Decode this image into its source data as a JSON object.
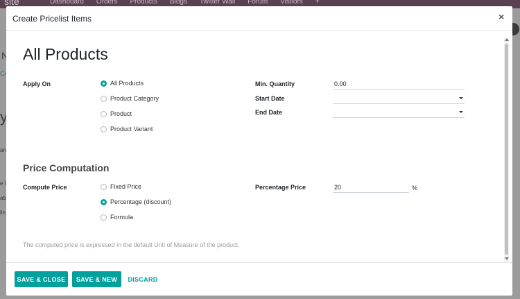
{
  "background": {
    "brand": "site",
    "menu": [
      "Dashboard",
      "Orders",
      "Products",
      "Blogs",
      "Twitter Wall",
      "Forum",
      "Visitors",
      "+"
    ],
    "fragments": [
      "N",
      "CA",
      "y",
      "an",
      "e l",
      "ab",
      "lin"
    ]
  },
  "modal": {
    "title": "Create Pricelist Items",
    "close": "×",
    "heading": "All Products",
    "apply_on": {
      "label": "Apply On",
      "options": [
        "All Products",
        "Product Category",
        "Product",
        "Product Variant"
      ],
      "selected": "All Products"
    },
    "min_quantity": {
      "label": "Min. Quantity",
      "value": "0.00"
    },
    "start_date": {
      "label": "Start Date",
      "value": ""
    },
    "end_date": {
      "label": "End Date",
      "value": ""
    },
    "price_computation": {
      "title": "Price Computation",
      "compute_label": "Compute Price",
      "options": [
        "Fixed Price",
        "Percentage (discount)",
        "Formula"
      ],
      "selected": "Percentage (discount)",
      "percentage_label": "Percentage Price",
      "percentage_value": "20",
      "percentage_unit": "%"
    },
    "help_text": "The computed price is expressed in the default Unit of Measure of the product.",
    "buttons": {
      "save_close": "SAVE & CLOSE",
      "save_new": "SAVE & NEW",
      "discard": "DISCARD"
    }
  },
  "colors": {
    "accent": "#00a09d",
    "topbar": "#5a4152"
  }
}
